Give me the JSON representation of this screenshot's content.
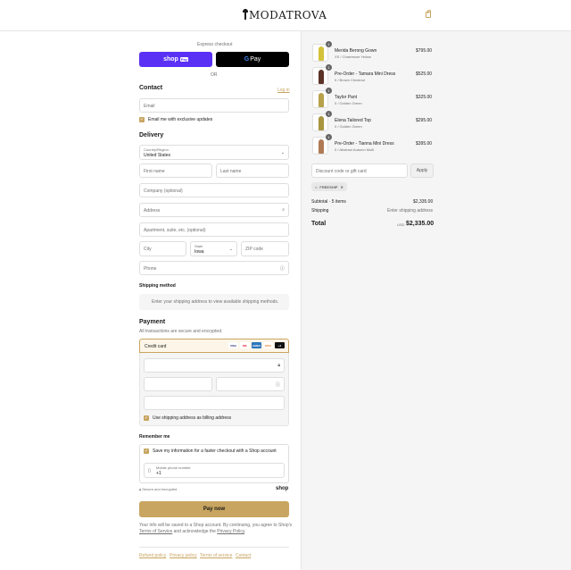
{
  "brand": {
    "logo_text": "MODATROVA",
    "accent": "#c8a560"
  },
  "express": {
    "label": "Express checkout",
    "shop_pay_label": "shop",
    "shop_pay_badge": "Pay",
    "gpay_g": "G",
    "gpay_label": "Pay",
    "or_label": "OR"
  },
  "contact": {
    "title": "Contact",
    "login_link": "Log in",
    "email_placeholder": "Email",
    "offers_label": "Email me with exclusive updates"
  },
  "delivery": {
    "title": "Delivery",
    "country_label": "Country/Region",
    "country_value": "United States",
    "first_name_placeholder": "First name",
    "last_name_placeholder": "Last name",
    "company_placeholder": "Company (optional)",
    "address_placeholder": "Address",
    "apartment_placeholder": "Apartment, suite, etc. (optional)",
    "city_placeholder": "City",
    "state_label": "State",
    "state_value": "Iowa",
    "zip_placeholder": "ZIP code",
    "phone_placeholder": "Phone"
  },
  "shipping_method": {
    "title": "Shipping method",
    "message": "Enter your shipping address to view available shipping methods."
  },
  "payment": {
    "title": "Payment",
    "subtitle": "All transactions are secure and encrypted.",
    "credit_card_label": "Credit card",
    "cards": [
      {
        "name": "VISA",
        "color": "#1a1f71"
      },
      {
        "name": "MC",
        "color": "#eb001b"
      },
      {
        "name": "AMEX",
        "color": "#2e77bb"
      },
      {
        "name": "DISC",
        "color": "#f58220"
      }
    ],
    "more_cards": "+4",
    "billing_label": "Use shipping address as billing address"
  },
  "remember": {
    "title": "Remember me",
    "save_label": "Save my information for a faster checkout with a Shop account",
    "mobile_label": "Mobile phone number",
    "mobile_value": "+1",
    "secure_label": "Secure and encrypted",
    "shop_label": "shop"
  },
  "pay_button": "Pay now",
  "fine_print": {
    "text1": "Your info will be saved to a Shop account. By continuing, you agree to Shop's",
    "terms": "Terms of Service",
    "text2": " and acknowledge the ",
    "privacy": "Privacy Policy",
    "end": "."
  },
  "footer": {
    "links": [
      "Refund policy",
      "Privacy policy",
      "Terms of service",
      "Contact"
    ]
  },
  "order": {
    "items": [
      {
        "name": "Merida Berong Gown",
        "variant": "XS / Chartreuse Yellow",
        "price": "$795.00",
        "qty": "1",
        "color": "#d4c23a"
      },
      {
        "name": "Pre-Order - Tamara Mini Dress",
        "variant": "0 / Brown Chestnut",
        "price": "$525.00",
        "qty": "1",
        "color": "#5b3226"
      },
      {
        "name": "Taylor Pant",
        "variant": "0 / Golden Green",
        "price": "$325.00",
        "qty": "1",
        "color": "#b8a14a"
      },
      {
        "name": "Elena Tailored Top",
        "variant": "0 / Golden Green",
        "price": "$295.00",
        "qty": "1",
        "color": "#a8953f"
      },
      {
        "name": "Pre-Order - Tianna Mini Dress",
        "variant": "0 / Abstract Autumn Multi",
        "price": "$395.00",
        "qty": "1",
        "color": "#b07a55"
      }
    ],
    "discount_placeholder": "Discount code or gift card",
    "apply_label": "Apply",
    "discount_tag": "FREESHIP",
    "subtotal_label": "Subtotal · 5 items",
    "subtotal_value": "$2,335.00",
    "shipping_label": "Shipping",
    "shipping_value": "Enter shipping address",
    "total_label": "Total",
    "total_currency": "USD",
    "total_value": "$2,335.00"
  }
}
